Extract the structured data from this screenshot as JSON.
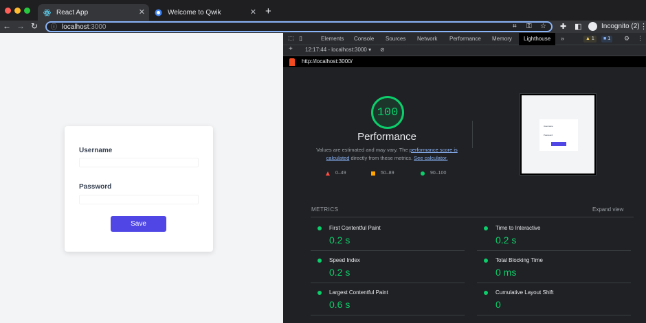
{
  "browser": {
    "tabs": [
      {
        "title": "React App",
        "icon": "react-icon",
        "active": true
      },
      {
        "title": "Welcome to Qwik",
        "icon": "globe-icon",
        "active": false
      }
    ],
    "new_tab": "+",
    "address": {
      "host": "localhost",
      "port": ":3000"
    },
    "profile_label": "Incognito (2)",
    "icons": [
      "back-icon",
      "forward-icon",
      "reload-icon",
      "info-icon",
      "qr-icon",
      "key-icon",
      "star-icon",
      "extensions-icon",
      "sidepanel-icon",
      "menu-icon"
    ]
  },
  "page": {
    "username_label": "Username",
    "password_label": "Password",
    "save_label": "Save",
    "colors": {
      "primary": "#4f46e5",
      "background": "#f3f4f6"
    }
  },
  "devtools": {
    "tabs": [
      "Elements",
      "Console",
      "Sources",
      "Network",
      "Performance",
      "Memory",
      "Lighthouse"
    ],
    "active_tab": "Lighthouse",
    "more": "»",
    "warnings": "1",
    "messages": "1",
    "report_selector": "12:17:44 - localhost:3000",
    "report_url": "http://localhost:3000/"
  },
  "lighthouse": {
    "score": "100",
    "category": "Performance",
    "desc_before": "Values are estimated and may vary. The ",
    "desc_link1": "performance score is calculated",
    "desc_middle": " directly from these metrics. ",
    "desc_link2": "See calculator.",
    "legend": [
      {
        "range": "0–49",
        "color": "#ff4e42"
      },
      {
        "range": "50–89",
        "color": "#ffa400"
      },
      {
        "range": "90–100",
        "color": "#0cce6b"
      }
    ],
    "metrics_heading": "METRICS",
    "expand_label": "Expand view",
    "metrics": [
      {
        "title": "First Contentful Paint",
        "value": "0.2 s"
      },
      {
        "title": "Time to Interactive",
        "value": "0.2 s"
      },
      {
        "title": "Speed Index",
        "value": "0.2 s"
      },
      {
        "title": "Total Blocking Time",
        "value": "0 ms"
      },
      {
        "title": "Largest Contentful Paint",
        "value": "0.6 s"
      },
      {
        "title": "Cumulative Layout Shift",
        "value": "0"
      }
    ],
    "good_color": "#0cce6b"
  }
}
